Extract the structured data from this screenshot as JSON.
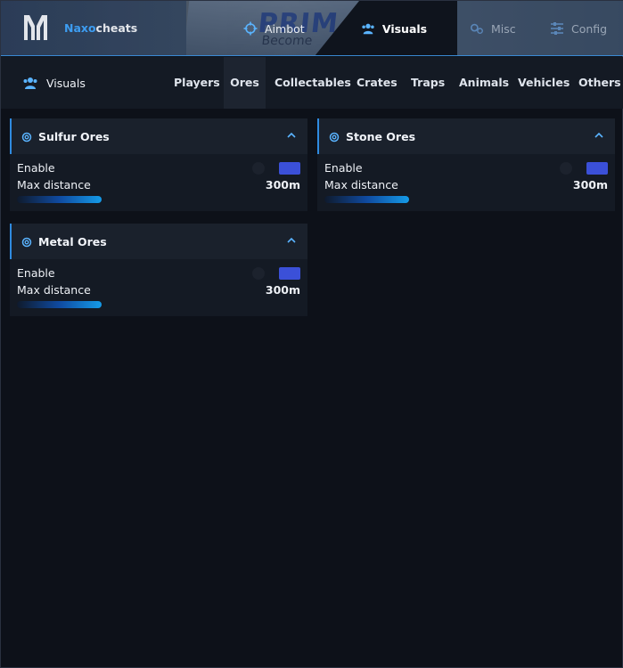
{
  "app": {
    "brand_part1": "Naxo",
    "brand_part2": "cheats",
    "accent_color": "#3ea5ff",
    "toggle_on_color": "#3b50d8",
    "billboard_text": "PRIM",
    "billboard_subtext": "Become"
  },
  "tabs": {
    "aimbot": {
      "label": "Aimbot",
      "icon": "crosshair-icon"
    },
    "visuals": {
      "label": "Visuals",
      "icon": "users-icon"
    },
    "misc": {
      "label": "Misc",
      "icon": "gears-icon"
    },
    "config": {
      "label": "Config",
      "icon": "sliders-icon"
    }
  },
  "subnav": {
    "title": "Visuals",
    "items": [
      "Players",
      "Ores",
      "Collectables",
      "Crates",
      "Traps",
      "Animals",
      "Vehicles",
      "Others"
    ],
    "active": "Ores"
  },
  "cards": [
    {
      "title": "Sulfur Ores",
      "enable_label": "Enable",
      "enabled": true,
      "distance_label": "Max distance",
      "distance_value": "300m"
    },
    {
      "title": "Stone Ores",
      "enable_label": "Enable",
      "enabled": true,
      "distance_label": "Max distance",
      "distance_value": "300m"
    },
    {
      "title": "Metal Ores",
      "enable_label": "Enable",
      "enabled": true,
      "distance_label": "Max distance",
      "distance_value": "300m"
    }
  ]
}
